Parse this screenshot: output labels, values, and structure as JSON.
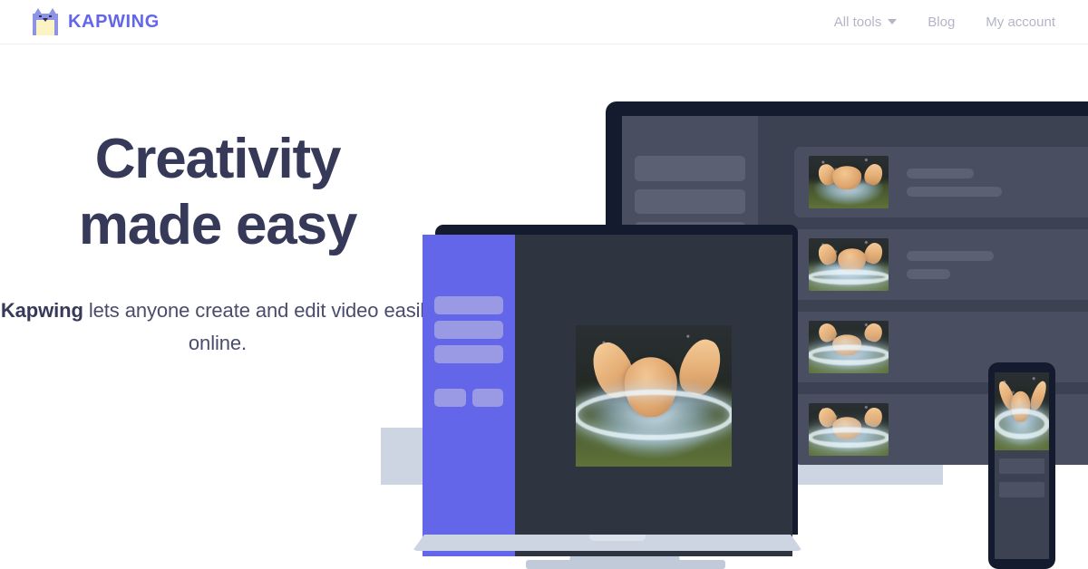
{
  "brand": {
    "name": "KAPWING",
    "logo_icon": "kapwing-cat-logo",
    "color": "#6366e8"
  },
  "nav": {
    "items": [
      {
        "label": "All tools",
        "has_dropdown": true,
        "icon": "chevron-down-icon"
      },
      {
        "label": "Blog",
        "has_dropdown": false
      },
      {
        "label": "My account",
        "has_dropdown": false
      }
    ],
    "color": "#b4b5c6"
  },
  "hero": {
    "headline_line1": "Creativity",
    "headline_line2": "made easy",
    "headline_color": "#373959",
    "subhead_brand": "Kapwing",
    "subhead_rest": " lets anyone create and edit video easily online."
  },
  "illustration": {
    "name": "devices-mockup",
    "monitor": {
      "name": "desktop-monitor",
      "bezel_color": "#151b2e",
      "screen_color": "#3c4252",
      "sidebar_color": "#494f60",
      "placeholder_color": "#5b6173",
      "chin_color": "#ccd5e1",
      "sidebar_bars": [
        "b1",
        "b2",
        "b3",
        "b4"
      ],
      "rows": [
        {
          "thumb": "video-thumbnail-1",
          "line_widths": [
            "74px",
            "105px"
          ]
        },
        {
          "thumb": "video-thumbnail-2",
          "line_widths": [
            "96px",
            "48px"
          ]
        },
        {
          "thumb": "video-thumbnail-3",
          "line_widths": []
        },
        {
          "thumb": "video-thumbnail-4",
          "line_widths": []
        }
      ]
    },
    "laptop": {
      "name": "laptop",
      "lid_color": "#151b2e",
      "screen_color": "#2f3441",
      "sidebar_color": "#6366e8",
      "placeholder_color": "#9a9ae4",
      "base_color": "#ccd5e1",
      "sidebar_bars": 3,
      "sidebar_split_bars": 2,
      "preview": "video-preview"
    },
    "phone": {
      "name": "smartphone",
      "frame_color": "#151b2e",
      "screen_color": "#3c4252",
      "placeholder_color": "#4c5264",
      "preview": "video-preview",
      "bars": 2
    }
  }
}
